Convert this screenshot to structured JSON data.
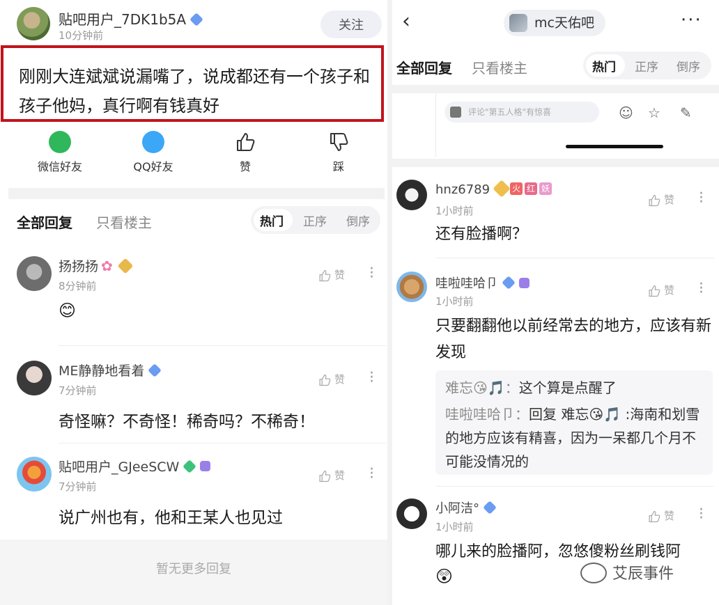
{
  "left": {
    "post": {
      "username": "贴吧用户_7DK1b5A",
      "time": "10分钟前",
      "follow_label": "关注",
      "text": "刚刚大连斌斌说漏嘴了，说成都还有一个孩子和孩子他妈，真行啊有钱真好"
    },
    "share": [
      {
        "label": "微信好友",
        "icon": "wechat-icon"
      },
      {
        "label": "QQ好友",
        "icon": "qq-icon"
      },
      {
        "label": "赞",
        "icon": "thumbs-up-icon"
      },
      {
        "label": "踩",
        "icon": "thumbs-down-icon"
      }
    ],
    "tabs": {
      "all": "全部回复",
      "host_only": "只看楼主",
      "sort": [
        "热门",
        "正序",
        "倒序"
      ],
      "active_sort": "热门"
    },
    "comments": [
      {
        "name": "扬扬扬",
        "time": "8分钟前",
        "text": "😊",
        "like_label": "赞"
      },
      {
        "name": "ME静静地看着",
        "time": "7分钟前",
        "text": "奇怪嘛？不奇怪！稀奇吗？不稀奇！",
        "like_label": "赞"
      },
      {
        "name": "贴吧用户_GJeeSCW",
        "time": "7分钟前",
        "text": "说广州也有，他和王某人也见过",
        "like_label": "赞"
      }
    ],
    "no_more": "暂无更多回复"
  },
  "right": {
    "forum_name": "mc天佑吧",
    "tabs": {
      "all": "全部回复",
      "host_only": "只看楼主",
      "sort": [
        "热门",
        "正序",
        "倒序"
      ],
      "active_sort": "热门"
    },
    "input_placeholder": "评论\"第五人格\"有惊喜",
    "comments": [
      {
        "name": "hnz6789",
        "tags": [
          "火",
          "红",
          "妖"
        ],
        "time": "1小时前",
        "text": "还有脸播啊？",
        "like_label": "赞"
      },
      {
        "name": "哇啦哇哈卩",
        "time": "1小时前",
        "text": "只要翻翻他以前经常去的地方，应该有新发现",
        "like_label": "赞"
      },
      {
        "name": "小阿洁°",
        "time": "1小时前",
        "text": "哪儿来的脸播阿，忽悠傻粉丝刷钱阿",
        "like_label": "赞"
      }
    ],
    "reply_box": {
      "line1_name": "难忘😘🎵：",
      "line1_text": "这个算是点醒了",
      "line2_name": "哇啦哇哈卩：",
      "line2_text": "回复 难忘😘🎵 :海南和划雪的地方应该有精喜，因为一呆都几个月不可能没情况的"
    },
    "watermark": "艾辰事件"
  }
}
